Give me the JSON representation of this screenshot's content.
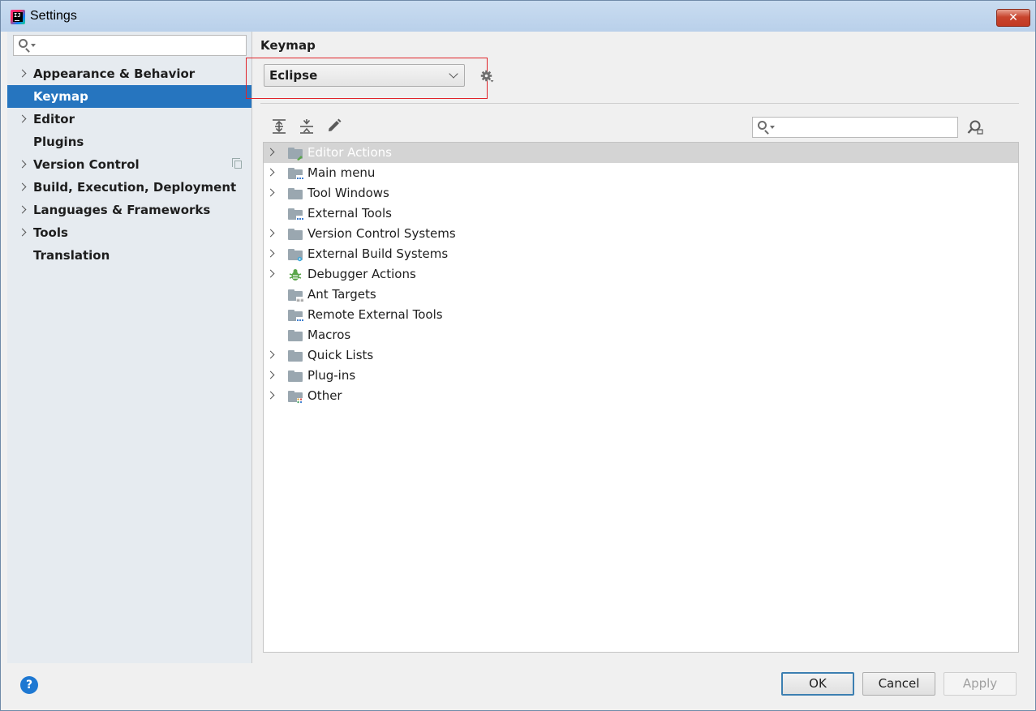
{
  "window": {
    "title": "Settings",
    "close_glyph": "✕"
  },
  "sidebar": {
    "search_placeholder": "",
    "items": [
      {
        "label": "Appearance & Behavior",
        "expandable": true,
        "selected": false
      },
      {
        "label": "Keymap",
        "expandable": false,
        "selected": true
      },
      {
        "label": "Editor",
        "expandable": true,
        "selected": false
      },
      {
        "label": "Plugins",
        "expandable": false,
        "selected": false
      },
      {
        "label": "Version Control",
        "expandable": true,
        "selected": false,
        "has_copy_icon": true
      },
      {
        "label": "Build, Execution, Deployment",
        "expandable": true,
        "selected": false
      },
      {
        "label": "Languages & Frameworks",
        "expandable": true,
        "selected": false
      },
      {
        "label": "Tools",
        "expandable": true,
        "selected": false
      },
      {
        "label": "Translation",
        "expandable": false,
        "selected": false
      }
    ]
  },
  "main": {
    "title": "Keymap",
    "keymap_selected": "Eclipse",
    "tree": [
      {
        "label": "Editor Actions",
        "expandable": true,
        "selected": true,
        "icon": "folder-edit-icon"
      },
      {
        "label": "Main menu",
        "expandable": true,
        "selected": false,
        "icon": "folder-menu-icon"
      },
      {
        "label": "Tool Windows",
        "expandable": true,
        "selected": false,
        "icon": "folder-icon"
      },
      {
        "label": "External Tools",
        "expandable": false,
        "selected": false,
        "icon": "folder-tools-icon"
      },
      {
        "label": "Version Control Systems",
        "expandable": true,
        "selected": false,
        "icon": "folder-icon"
      },
      {
        "label": "External Build Systems",
        "expandable": true,
        "selected": false,
        "icon": "folder-gear-icon"
      },
      {
        "label": "Debugger Actions",
        "expandable": true,
        "selected": false,
        "icon": "bug-icon"
      },
      {
        "label": "Ant Targets",
        "expandable": false,
        "selected": false,
        "icon": "folder-ant-icon"
      },
      {
        "label": "Remote External Tools",
        "expandable": false,
        "selected": false,
        "icon": "folder-tools-icon"
      },
      {
        "label": "Macros",
        "expandable": false,
        "selected": false,
        "icon": "folder-icon"
      },
      {
        "label": "Quick Lists",
        "expandable": true,
        "selected": false,
        "icon": "folder-icon"
      },
      {
        "label": "Plug-ins",
        "expandable": true,
        "selected": false,
        "icon": "folder-icon"
      },
      {
        "label": "Other",
        "expandable": true,
        "selected": false,
        "icon": "folder-other-icon"
      }
    ]
  },
  "footer": {
    "help_glyph": "?",
    "ok_label": "OK",
    "cancel_label": "Cancel",
    "apply_label": "Apply"
  },
  "colors": {
    "selection": "#2675bf",
    "highlight_box": "#e0242a",
    "folder": "#9aa7b0"
  }
}
